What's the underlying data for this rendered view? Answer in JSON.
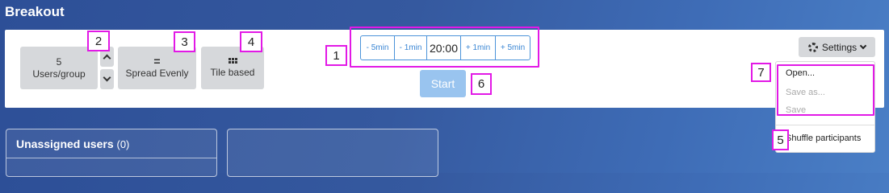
{
  "app": {
    "title": "Breakout"
  },
  "controls": {
    "users_group": {
      "value": "5",
      "label": "Users/group"
    },
    "spread": {
      "glyph": "=",
      "label": "Spread Evenly"
    },
    "tile": {
      "label": "Tile based"
    }
  },
  "timer": {
    "minus5": "- 5min",
    "minus1": "- 1min",
    "value": "20:00",
    "plus1": "+ 1min",
    "plus5": "+ 5min"
  },
  "start_label": "Start",
  "settings": {
    "label": "Settings",
    "menu": {
      "open": "Open...",
      "save_as": "Save as...",
      "save": "Save",
      "shuffle": "Shuffle participants"
    }
  },
  "cards": {
    "unassigned_title": "Unassigned users",
    "unassigned_count": "(0)"
  },
  "callouts": [
    "1",
    "2",
    "3",
    "4",
    "5",
    "6",
    "7"
  ],
  "colors": {
    "highlight": "#e219e6",
    "timer_accent": "#3a86d4",
    "start_button": "#99c4ef"
  }
}
